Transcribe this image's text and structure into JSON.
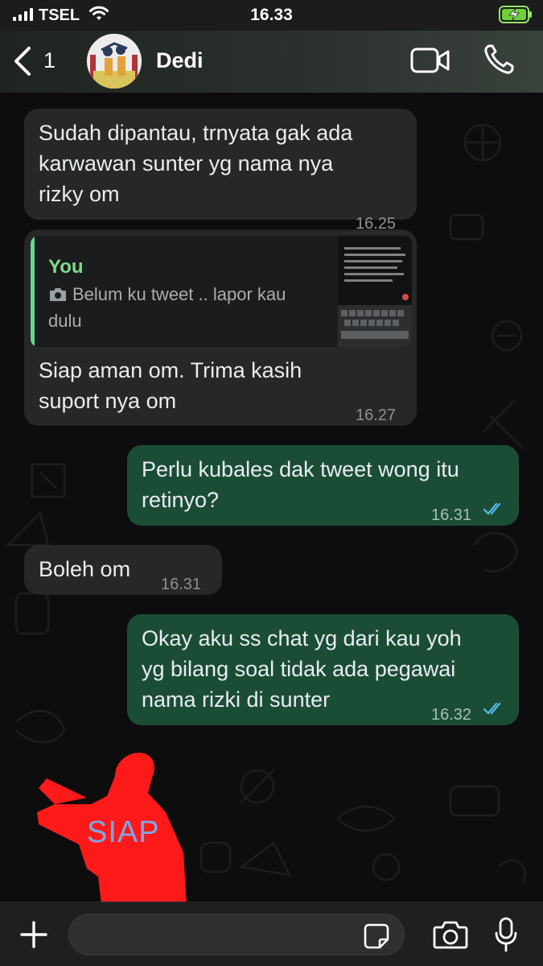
{
  "status_bar": {
    "carrier": "TSEL",
    "time": "16.33"
  },
  "header": {
    "back_count": "1",
    "contact_name": "Dedi"
  },
  "messages": [
    {
      "direction": "in",
      "text": "Sudah dipantau, trnyata gak ada\nkarwawan sunter yg nama nya\nrizky om",
      "time": "16.25"
    },
    {
      "direction": "in",
      "quote_author": "You",
      "quote_text": "Belum ku tweet .. lapor kau dulu",
      "text": "Siap aman om. Trima kasih\nsuport nya om",
      "time": "16.27"
    },
    {
      "direction": "out",
      "text": "Perlu kubales dak tweet wong itu\nretinyo?",
      "time": "16.31",
      "read": true
    },
    {
      "direction": "in",
      "text": "Boleh om",
      "time": "16.31"
    },
    {
      "direction": "out",
      "text": "Okay aku ss chat yg dari kau yoh\nyg bilang soal tidak ada pegawai\nnama rizki di sunter",
      "time": "16.32",
      "read": true
    }
  ],
  "sticker": {
    "text": "SIAP",
    "color": "#ff1a1a"
  },
  "input": {
    "placeholder": ""
  },
  "colors": {
    "incoming": "#262728",
    "outgoing": "#1b4d36",
    "accent_green": "#6bd58e",
    "read_ticks": "#53bdeb"
  }
}
